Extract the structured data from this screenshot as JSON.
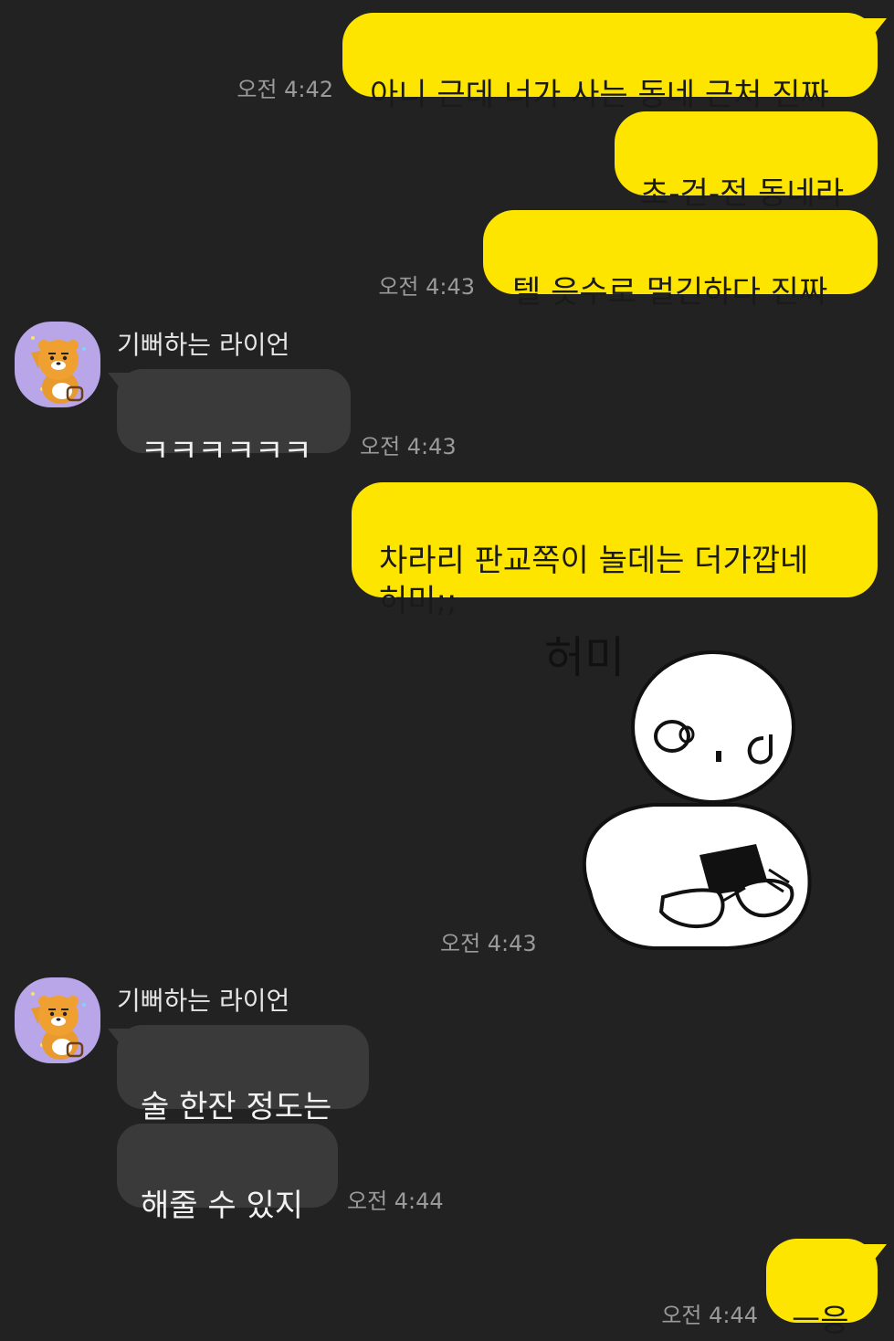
{
  "chat": {
    "messages": [
      {
        "text": "아니 근데 너가 사는 동네 근처 진짜",
        "time": "오전 4:42"
      },
      {
        "text": "초-건-전 동네라"
      },
      {
        "text": "텔 읏수로 멀긴하다 진짜",
        "time": "오전 4:43"
      },
      {
        "sender": "기뻐하는 라이언",
        "text": "ㅋㅋㅋㅋㅋㅋ",
        "time": "오전 4:43"
      },
      {
        "text": "차라리 판교쪽이 놀데는  더가깝네\n허미;;"
      },
      {
        "sticker_caption": "허미",
        "sticker_icon": "shocked-person-with-phone-sticker",
        "time": "오전 4:43"
      },
      {
        "sender": "기뻐하는 라이언",
        "text": "술 한잔 정도는"
      },
      {
        "text": "해줄 수 있지",
        "time": "오전 4:44"
      },
      {
        "text": "ㅡ응",
        "time": "오전 4:44"
      }
    ]
  },
  "colors": {
    "background": "#222222",
    "my_bubble": "#FEE500",
    "other_bubble": "#3A3A3A",
    "timestamp": "#9A9A9A",
    "avatar_bg": "#B8A6E8"
  },
  "icons": {
    "avatar": "ryan-lion-avatar-icon"
  }
}
